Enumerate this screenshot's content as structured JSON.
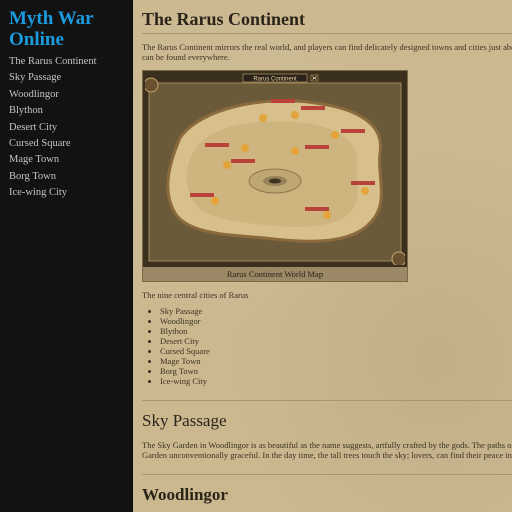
{
  "site": {
    "title": "Myth War Online"
  },
  "nav": {
    "items": [
      {
        "label": "The Rarus Continent"
      },
      {
        "label": "Sky Passage"
      },
      {
        "label": "Woodlingor"
      },
      {
        "label": "Blython"
      },
      {
        "label": "Desert City"
      },
      {
        "label": "Cursed Square"
      },
      {
        "label": "Mage Town"
      },
      {
        "label": "Borg Town"
      },
      {
        "label": "Ice-wing City"
      }
    ]
  },
  "main": {
    "heading": "The Rarus Continent",
    "intro": "The Rarus Continent mirrors the real world, and players can find delicately designed towns and cities just about everywhere and exquisite scenes can be found everywhere.",
    "map": {
      "title": "Rarus Continent",
      "caption": "Rarus Continent World Map"
    },
    "cities_intro": "The nine central cities of Rarus",
    "cities": [
      "Sky Passage",
      "Woodlingor",
      "Blython",
      "Desert City",
      "Cursed Square",
      "Mage Town",
      "Borg Town",
      "Ice-wing City"
    ],
    "sky_passage": {
      "heading": "Sky Passage",
      "text": "The Sky Garden in Woodlingor is as beautiful as the name suggests, artfully crafted by the gods. The paths of soft snowy ground make the Sky Garden unconventionally graceful. In the day time, the tall trees touch the sky; lovers, can find their peace in this special location."
    },
    "woodlingor": {
      "heading": "Woodlingor"
    }
  },
  "colors": {
    "sidebar_bg": "#121212",
    "title_blue": "#1a9be0",
    "parchment": "#cbb88f"
  }
}
